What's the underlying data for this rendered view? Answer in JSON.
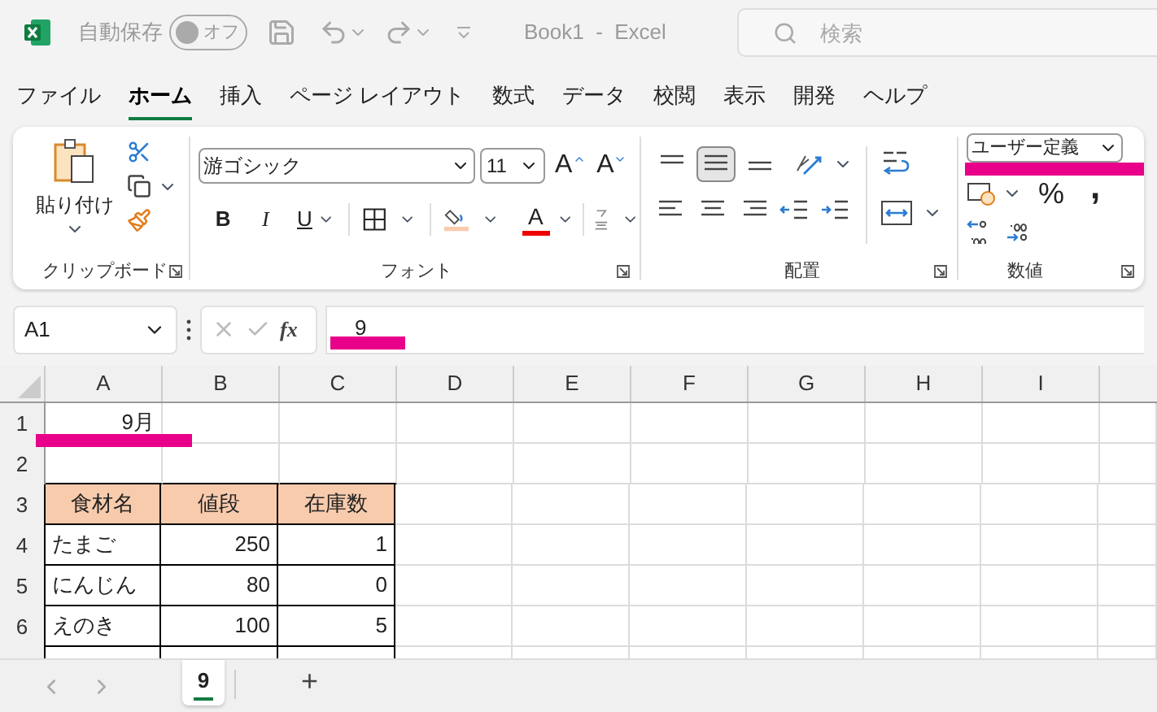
{
  "title_bar": {
    "autosave_label": "自動保存",
    "autosave_toggle": {
      "label": "オフ",
      "on": false
    },
    "title": "Book1  -  Excel",
    "search": {
      "placeholder": "検索"
    }
  },
  "menu_tabs": [
    {
      "label": "ファイル",
      "selected": false
    },
    {
      "label": "ホーム",
      "selected": true
    },
    {
      "label": "挿入",
      "selected": false
    },
    {
      "label": "ページ レイアウト",
      "selected": false
    },
    {
      "label": "数式",
      "selected": false
    },
    {
      "label": "データ",
      "selected": false
    },
    {
      "label": "校閲",
      "selected": false
    },
    {
      "label": "表示",
      "selected": false
    },
    {
      "label": "開発",
      "selected": false
    },
    {
      "label": "ヘルプ",
      "selected": false
    }
  ],
  "ribbon": {
    "clipboard": {
      "paste_label": "貼り付け",
      "group_label": "クリップボード"
    },
    "font": {
      "font_name": "游ゴシック",
      "font_size": "11",
      "grow_label": "A",
      "shrink_label": "A",
      "bold": "B",
      "italic": "I",
      "underline": "U",
      "font_color_label": "A",
      "group_label": "フォント"
    },
    "alignment": {
      "group_label": "配置",
      "middle_align_selected": true
    },
    "number": {
      "format": "ユーザー定義",
      "percent": "%",
      "comma": ",",
      "group_label": "数値"
    }
  },
  "formula_bar": {
    "name_box": "A1",
    "function_label": "fx",
    "formula": "9"
  },
  "grid": {
    "columns": [
      "A",
      "B",
      "C",
      "D",
      "E",
      "F",
      "G",
      "H",
      "I"
    ],
    "rows": [
      {
        "number": "1",
        "kind": "plain",
        "cells": [
          {
            "text": "9月",
            "kind": "number"
          }
        ]
      },
      {
        "number": "2",
        "kind": "plain"
      },
      {
        "number": "3",
        "kind": "header",
        "cells": [
          {
            "text": "食材名",
            "kind": "header"
          },
          {
            "text": "値段",
            "kind": "header"
          },
          {
            "text": "在庫数",
            "kind": "header"
          }
        ]
      },
      {
        "number": "4",
        "kind": "table",
        "cells": [
          {
            "text": "たまご",
            "kind": "text"
          },
          {
            "text": "250",
            "kind": "number"
          },
          {
            "text": "1",
            "kind": "number"
          }
        ]
      },
      {
        "number": "5",
        "kind": "table",
        "cells": [
          {
            "text": "にんじん",
            "kind": "text"
          },
          {
            "text": "80",
            "kind": "number"
          },
          {
            "text": "0",
            "kind": "number"
          }
        ]
      },
      {
        "number": "6",
        "kind": "table",
        "cells": [
          {
            "text": "えのき",
            "kind": "text"
          },
          {
            "text": "100",
            "kind": "number"
          },
          {
            "text": "5",
            "kind": "number"
          }
        ]
      },
      {
        "kind": "table"
      }
    ]
  },
  "sheet_tabs": [
    {
      "label": "9",
      "selected": true
    }
  ],
  "add_sheet": "+"
}
